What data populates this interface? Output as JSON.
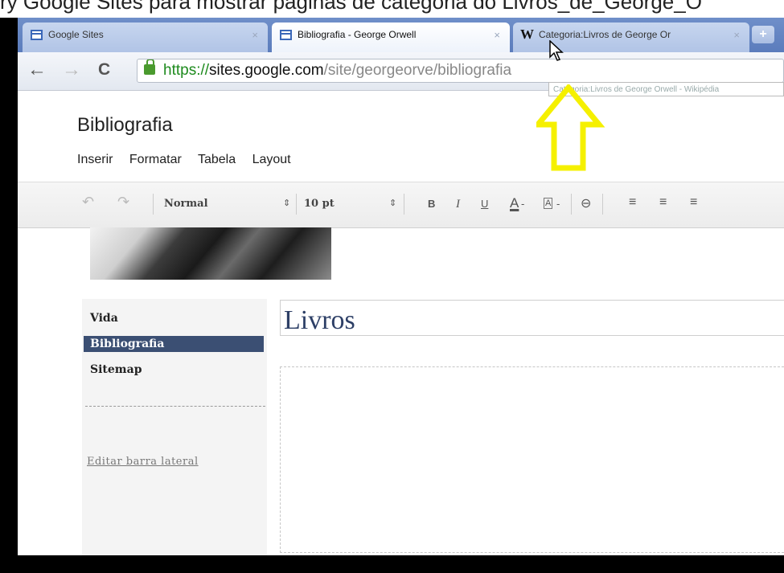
{
  "caption": "ry Google Sites para mostrar páginas de categoria do Livros_de_George_O",
  "tabs": [
    {
      "label": "Google Sites",
      "icon": "google-sites-icon",
      "close": "×"
    },
    {
      "label": "Bibliografia - George Orwell",
      "icon": "google-sites-icon",
      "close": "×"
    },
    {
      "label": "Categoria:Livros de George Or",
      "icon": "wikipedia-icon",
      "close": "×"
    }
  ],
  "new_tab": "+",
  "nav": {
    "back": "←",
    "forward": "→",
    "reload": "C"
  },
  "url": {
    "scheme": "https://",
    "host": "sites.google.com",
    "path": "/site/georgeorve/bibliografia"
  },
  "link_tooltip": "Categoria:Livros de George Orwell - Wikipédia",
  "page": {
    "title": "Bibliografia",
    "menu": [
      "Inserir",
      "Formatar",
      "Tabela",
      "Layout"
    ]
  },
  "toolbar": {
    "undo": "↶",
    "redo": "↷",
    "style": "Normal",
    "size": "10 pt",
    "select_arrow": "⇕",
    "bold": "B",
    "italic": "I",
    "underline": "U",
    "text_color": "A",
    "bg_color": "A",
    "dropdown": "-",
    "link": "⊖",
    "numbered_list": "≡",
    "bulleted_list": "≡",
    "indent": "≡"
  },
  "sidebar": {
    "items": [
      {
        "label": "Vida",
        "current": false
      },
      {
        "label": "Bibliografia",
        "current": true
      },
      {
        "label": "Sitemap",
        "current": false
      }
    ],
    "edit_link": "Editar barra lateral"
  },
  "content": {
    "heading": "Livros"
  },
  "colors": {
    "arrow": "#f5f000",
    "sidebar_current_bg": "#3b4f73",
    "heading": "#2d3f66",
    "url_scheme": "#1d8a1d"
  }
}
